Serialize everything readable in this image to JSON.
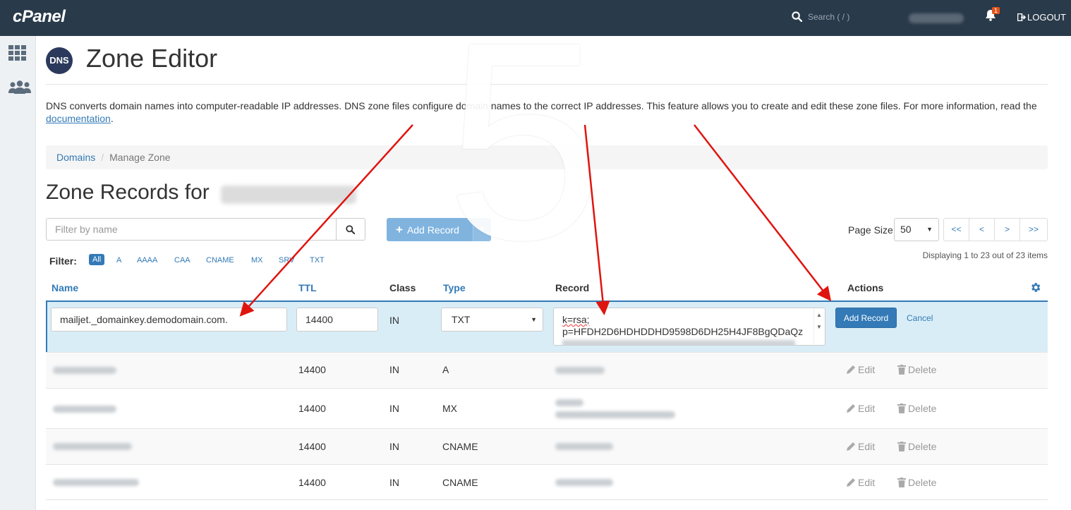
{
  "header": {
    "logo": "cPanel",
    "search_placeholder": "Search ( / )",
    "notification_count": "1",
    "logout_label": "LOGOUT"
  },
  "page": {
    "dns_logo_text": "DNS",
    "title": "Zone Editor",
    "description_before_link": "DNS converts domain names into computer-readable IP addresses. DNS zone files configure domain names to the correct IP addresses. This feature allows you to create and edit these zone files. For more information, read the ",
    "description_link": "documentation",
    "description_after_link": "."
  },
  "breadcrumb": {
    "item1": "Domains",
    "separator": "/",
    "item2": "Manage Zone"
  },
  "zone": {
    "title_prefix": "Zone Records for"
  },
  "toolbar": {
    "filter_placeholder": "Filter by name",
    "add_record_label": "Add Record",
    "page_size_label": "Page Size",
    "page_size_value": "50",
    "pager": [
      "<<",
      "<",
      ">",
      ">>"
    ],
    "displaying": "Displaying 1 to 23 out of 23 items"
  },
  "filter": {
    "label": "Filter:",
    "chips": [
      "All",
      "A",
      "AAAA",
      "CAA",
      "CNAME",
      "MX",
      "SRV",
      "TXT"
    ],
    "active": "All"
  },
  "table": {
    "headers": {
      "name": "Name",
      "ttl": "TTL",
      "class": "Class",
      "type": "Type",
      "record": "Record",
      "actions": "Actions"
    },
    "edit_row": {
      "name": "mailjet._domainkey.demodomain.com.",
      "ttl": "14400",
      "class": "IN",
      "type": "TXT",
      "record_line1": "k=rsa;",
      "record_line2": "p=HFDH2D6HDHDDHD9598D6DH25H4JF8BgQDaQz",
      "add_label": "Add Record",
      "cancel_label": "Cancel"
    },
    "rows": [
      {
        "ttl": "14400",
        "class": "IN",
        "type": "A"
      },
      {
        "ttl": "14400",
        "class": "IN",
        "type": "MX"
      },
      {
        "ttl": "14400",
        "class": "IN",
        "type": "CNAME"
      },
      {
        "ttl": "14400",
        "class": "IN",
        "type": "CNAME"
      }
    ],
    "edit_label": "Edit",
    "delete_label": "Delete"
  },
  "overlay": {
    "step_number": "5",
    "arrow_color": "#e0140f"
  }
}
